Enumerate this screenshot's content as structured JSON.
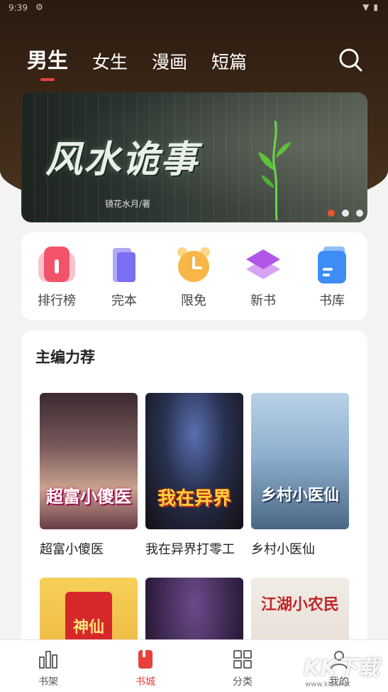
{
  "status_bar": {
    "time": "9:39",
    "gear_icon": "gear-icon",
    "wifi_icon": "wifi-icon",
    "battery_icon": "battery-icon"
  },
  "tabs": [
    {
      "label": "男生",
      "active": true
    },
    {
      "label": "女生",
      "active": false
    },
    {
      "label": "漫画",
      "active": false
    },
    {
      "label": "短篇",
      "active": false
    }
  ],
  "search": {
    "icon": "search-icon"
  },
  "banner": {
    "title": "风水诡事",
    "author": "镜花水月/著",
    "dots": 3,
    "active_dot": 0
  },
  "quick_links": [
    {
      "label": "排行榜",
      "icon": "ranking-icon",
      "color": "#f2536a"
    },
    {
      "label": "完本",
      "icon": "book-complete-icon",
      "color": "#7a6ff0"
    },
    {
      "label": "限免",
      "icon": "clock-icon",
      "color": "#f8b646"
    },
    {
      "label": "新书",
      "icon": "layers-icon",
      "color": "#b057e8"
    },
    {
      "label": "书库",
      "icon": "library-icon",
      "color": "#3d8df5"
    }
  ],
  "editor_picks": {
    "title": "主编力荐",
    "books": [
      {
        "title": "超富小傻医",
        "cover_text": "超富小傻医"
      },
      {
        "title": "我在异界打零工",
        "cover_text": "我在异界"
      },
      {
        "title": "乡村小医仙",
        "cover_text": "乡村小医仙"
      }
    ],
    "books_row2": [
      {
        "cover_text": "神仙"
      },
      {
        "cover_text": ""
      },
      {
        "cover_text": "江湖小农民"
      }
    ]
  },
  "bottom_nav": [
    {
      "label": "书架",
      "icon": "bookshelf-icon",
      "active": false
    },
    {
      "label": "书城",
      "icon": "bookstore-icon",
      "active": true
    },
    {
      "label": "分类",
      "icon": "category-grid-icon",
      "active": false
    },
    {
      "label": "我的",
      "icon": "profile-icon",
      "active": false
    }
  ],
  "watermark": {
    "text": "KK下载",
    "url": "www.kkx.net"
  },
  "colors": {
    "accent": "#e8403a",
    "dot_active": "#e8532c"
  }
}
